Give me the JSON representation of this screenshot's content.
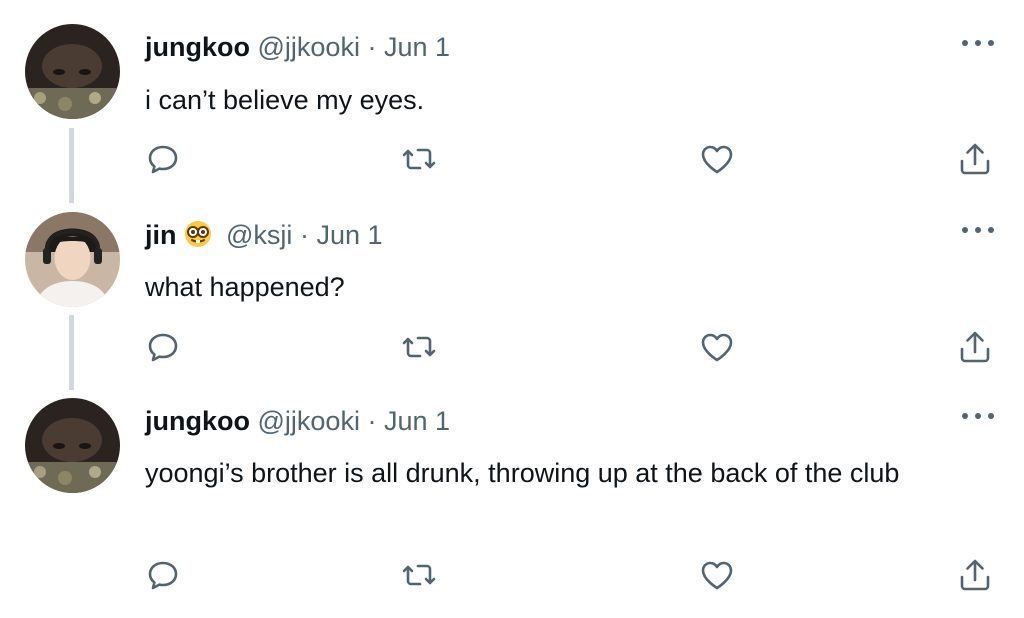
{
  "tweets": [
    {
      "name": "jungkoo",
      "handle": "@jjkooki",
      "separator": "·",
      "date": "Jun 1",
      "text": "i can’t believe my eyes.",
      "avatar": "avatar-dark-hoodie"
    },
    {
      "name": "jin",
      "emoji": "nerd-face-emoji",
      "handle": "@ksji",
      "separator": "·",
      "date": "Jun 1",
      "text": "what happened?",
      "avatar": "avatar-headphones"
    },
    {
      "name": "jungkoo",
      "handle": "@jjkooki",
      "separator": "·",
      "date": "Jun 1",
      "text": "yoongi’s brother is all drunk, throwing up at the back of the club",
      "avatar": "avatar-dark-hoodie"
    }
  ],
  "icons": {
    "reply": "reply-icon",
    "retweet": "retweet-icon",
    "like": "heart-icon",
    "share": "share-icon",
    "more": "more-icon"
  },
  "colors": {
    "text": "#0f1419",
    "muted": "#536471",
    "thread_line": "#cfd9de"
  }
}
